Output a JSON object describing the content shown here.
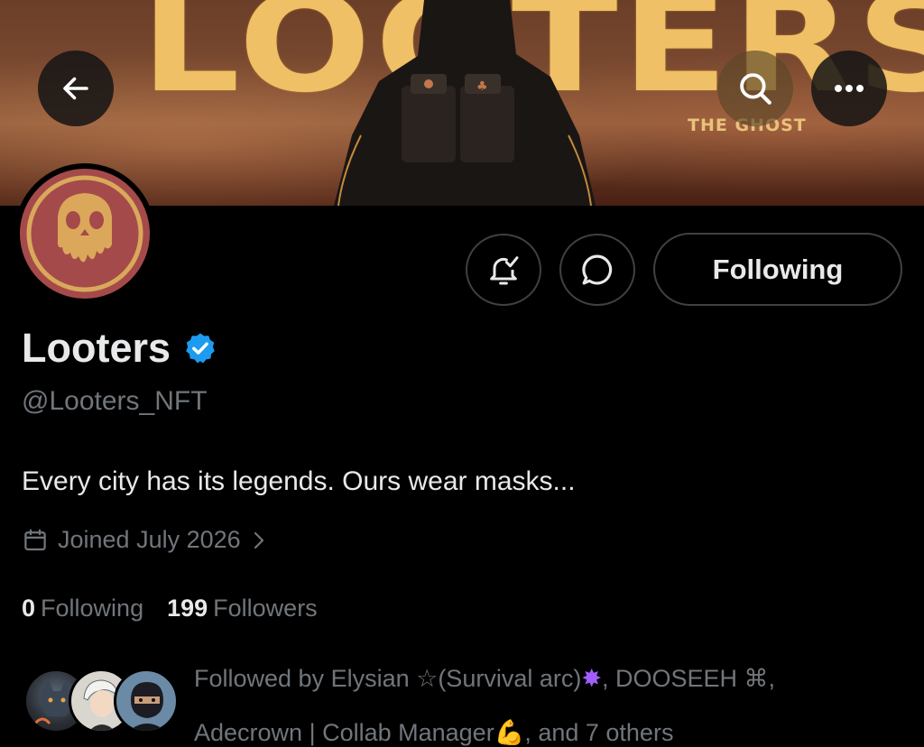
{
  "banner": {
    "title_art": "LOOTERS",
    "subtitle_art": "THE GHOST"
  },
  "nav": {
    "back_icon": "arrow-left-icon",
    "search_icon": "search-icon",
    "more_icon": "more-horizontal-icon"
  },
  "actions": {
    "notify_icon": "bell-check-icon",
    "message_icon": "chat-bubble-icon",
    "following_label": "Following"
  },
  "profile": {
    "name": "Looters",
    "verified_icon": "verified-badge-icon",
    "verified_color": "#1d9bf0",
    "handle": "@Looters_NFT",
    "bio": "Every city has its legends. Ours wear masks...",
    "joined": "Joined July 2026"
  },
  "stats": {
    "following_count": "0",
    "following_label": "Following",
    "followers_count": "199",
    "followers_label": "Followers"
  },
  "followed_by": {
    "line1_prefix": "Followed by Elysian ☆(Survival arc)",
    "line1_emoji": "✸",
    "line1_suffix": ", DOOSEEH ⌘,",
    "line2_text": "Adecrown | Collab Manager",
    "line2_emoji": "💪",
    "line2_suffix": ", and 7 others"
  },
  "colors": {
    "background": "#000000",
    "text_primary": "#e7e9ea",
    "text_secondary": "#71767b",
    "border": "#3e4145",
    "banner_gold": "#f0c067"
  }
}
